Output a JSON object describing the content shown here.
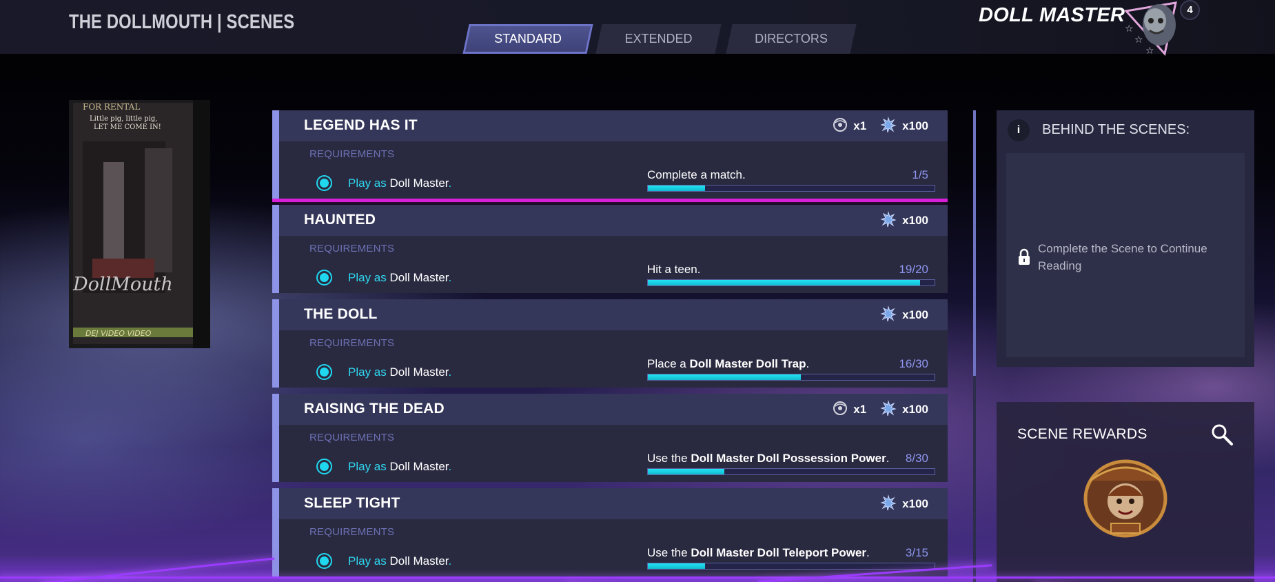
{
  "header": {
    "title": "THE DOLLMOUTH | SCENES",
    "tabs": [
      {
        "label": "STANDARD",
        "active": true
      },
      {
        "label": "EXTENDED",
        "active": false
      },
      {
        "label": "DIRECTORS",
        "active": false
      }
    ],
    "character_name": "DOLL MASTER",
    "level": "4"
  },
  "scenes": [
    {
      "title": "LEGEND HAS IT",
      "selected": true,
      "rewards": [
        {
          "icon": "tape-reel-icon",
          "count": "x1"
        },
        {
          "icon": "xp-splat-icon",
          "count": "x100"
        }
      ],
      "requirements_label": "REQUIREMENTS",
      "req_prefix": "Play as",
      "req_character": "Doll Master",
      "req_suffix": ".",
      "task_prefix": "Complete a match.",
      "task_highlight": "",
      "task_suffix": "",
      "count": "1/5",
      "progress": 0.2
    },
    {
      "title": "HAUNTED",
      "selected": false,
      "rewards": [
        {
          "icon": "xp-splat-icon",
          "count": "x100"
        }
      ],
      "requirements_label": "REQUIREMENTS",
      "req_prefix": "Play as",
      "req_character": "Doll Master",
      "req_suffix": ".",
      "task_prefix": "Hit a teen.",
      "task_highlight": "",
      "task_suffix": "",
      "count": "19/20",
      "progress": 0.95
    },
    {
      "title": "THE DOLL",
      "selected": false,
      "rewards": [
        {
          "icon": "xp-splat-icon",
          "count": "x100"
        }
      ],
      "requirements_label": "REQUIREMENTS",
      "req_prefix": "Play as",
      "req_character": "Doll Master",
      "req_suffix": ".",
      "task_prefix": "Place a ",
      "task_highlight": "Doll Master Doll Trap",
      "task_suffix": ".",
      "count": "16/30",
      "progress": 0.533
    },
    {
      "title": "RAISING THE DEAD",
      "selected": false,
      "rewards": [
        {
          "icon": "tape-reel-icon",
          "count": "x1"
        },
        {
          "icon": "xp-splat-icon",
          "count": "x100"
        }
      ],
      "requirements_label": "REQUIREMENTS",
      "req_prefix": "Play as",
      "req_character": "Doll Master",
      "req_suffix": ".",
      "task_prefix": "Use the ",
      "task_highlight": "Doll Master Doll Possession Power",
      "task_suffix": ".",
      "count": "8/30",
      "progress": 0.267
    },
    {
      "title": "SLEEP TIGHT",
      "selected": false,
      "rewards": [
        {
          "icon": "xp-splat-icon",
          "count": "x100"
        }
      ],
      "requirements_label": "REQUIREMENTS",
      "req_prefix": "Play as",
      "req_character": "Doll Master",
      "req_suffix": ".",
      "task_prefix": "Use the ",
      "task_highlight": "Doll Master Doll Teleport Power",
      "task_suffix": ".",
      "count": "3/15",
      "progress": 0.2
    }
  ],
  "behind_the_scenes": {
    "info_glyph": "i",
    "title": "BEHIND THE SCENES:",
    "locked_text": "Complete the Scene to Continue Reading"
  },
  "scene_rewards": {
    "title": "SCENE REWARDS",
    "badge": "dollmouth-inn-badge"
  },
  "vhs_cover": {
    "sticker": "FOR RENTAL",
    "tagline": "Little pig, little pig, LET ME COME IN!",
    "title": "DollMouth",
    "footer": "DEJ VIDEO VIDEO"
  },
  "colors": {
    "accent_cyan": "#1fd8ef",
    "selected_outline": "#d71fd7",
    "card_stripe": "#8d93e6",
    "count_color": "#8f96f0"
  }
}
